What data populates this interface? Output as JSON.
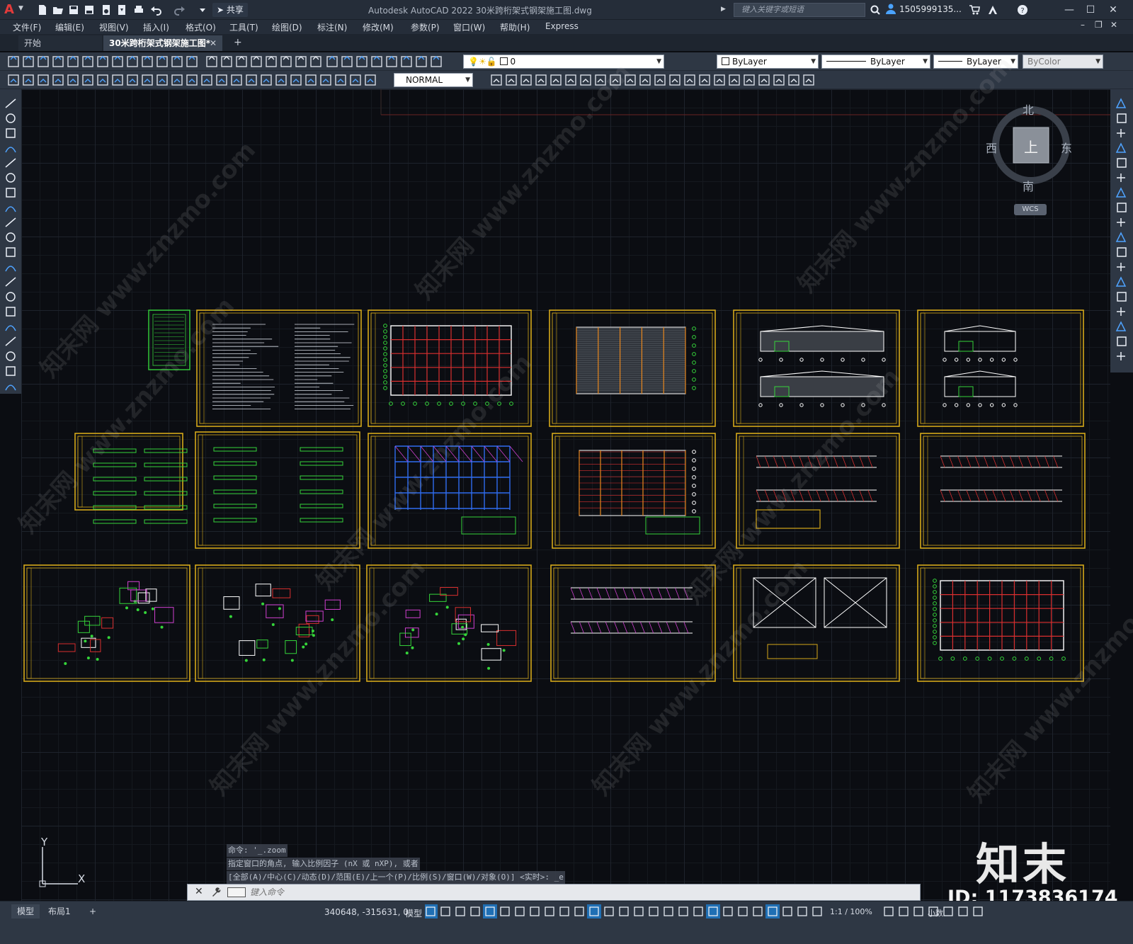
{
  "window": {
    "title": "Autodesk AutoCAD 2022    30米跨桁架式钢架施工图.dwg",
    "share": "共享",
    "search_placeholder": "键入关键字或短语",
    "user": "1505999135..."
  },
  "menu": [
    "文件(F)",
    "编辑(E)",
    "视图(V)",
    "插入(I)",
    "格式(O)",
    "工具(T)",
    "绘图(D)",
    "标注(N)",
    "修改(M)",
    "参数(P)",
    "窗口(W)",
    "帮助(H)",
    "Express"
  ],
  "tabs": {
    "start": "开始",
    "drawing": "30米跨桁架式钢架施工图*"
  },
  "properties": {
    "layer": "0",
    "color": "ByLayer",
    "linetype": "ByLayer",
    "lineweight": "ByLayer",
    "plotstyle": "ByColor",
    "dimstyle": "NORMAL"
  },
  "viewcube": {
    "north": "北",
    "south": "南",
    "east": "东",
    "west": "西",
    "top": "上",
    "wcs": "WCS"
  },
  "ucs": {
    "x": "X",
    "y": "Y"
  },
  "command": {
    "history": [
      "命令: '_.zoom",
      "指定窗口的角点, 输入比例因子 (nX 或 nXP), 或者",
      "[全部(A)/中心(C)/动态(D)/范围(E)/上一个(P)/比例(S)/窗口(W)/对象(O)] <实时>: _e"
    ],
    "placeholder": "键入命令"
  },
  "status": {
    "model_tab": "模型",
    "layout_tab": "布局1",
    "coords": "340648, -315631, 0",
    "space": "模型",
    "scale": "1:1 / 100%",
    "units": "小数"
  },
  "brand": {
    "logo": "知末",
    "id": "ID: 1173836174"
  },
  "watermark": "知末网 www.znzmo.com",
  "colors": {
    "frame": "#d4a81a",
    "grid_red": "#d92f2f",
    "cad_green": "#35d43a",
    "cad_blue": "#2f6cf0",
    "cad_magenta": "#d040d0"
  }
}
